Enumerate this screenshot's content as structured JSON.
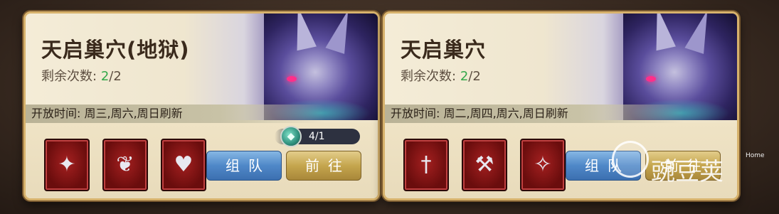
{
  "cards": [
    {
      "title": "天启巢穴(地狱)",
      "remaining_label": "剩余次数:",
      "remaining_current": "2",
      "remaining_total": "/2",
      "schedule": "开放时间: 周三,周六,周日刷新",
      "items": [
        {
          "icon": "pink-amulet-icon",
          "glyph": "✦"
        },
        {
          "icon": "pink-earrings-icon",
          "glyph": "❦"
        },
        {
          "icon": "heart-necklace-icon",
          "glyph": "♥"
        }
      ],
      "ticket_count": "4/1",
      "team_button": "组队",
      "go_button": "前往"
    },
    {
      "title": "天启巢穴",
      "remaining_label": "剩余次数:",
      "remaining_current": "2",
      "remaining_total": "/2",
      "schedule": "开放时间: 周二,周四,周六,周日刷新",
      "items": [
        {
          "icon": "dark-dagger-icon",
          "glyph": "†"
        },
        {
          "icon": "battle-axe-icon",
          "glyph": "⚒"
        },
        {
          "icon": "spiked-mace-icon",
          "glyph": "✧"
        }
      ],
      "team_button": "组队",
      "go_button": "前往"
    }
  ],
  "watermark": {
    "text": "豌豆荚",
    "home": "Home"
  },
  "colors": {
    "remaining_current": "#34a84a",
    "team_button": "#4f88c8",
    "go_button": "#c5a64e",
    "item_frame": "#8a1414"
  }
}
